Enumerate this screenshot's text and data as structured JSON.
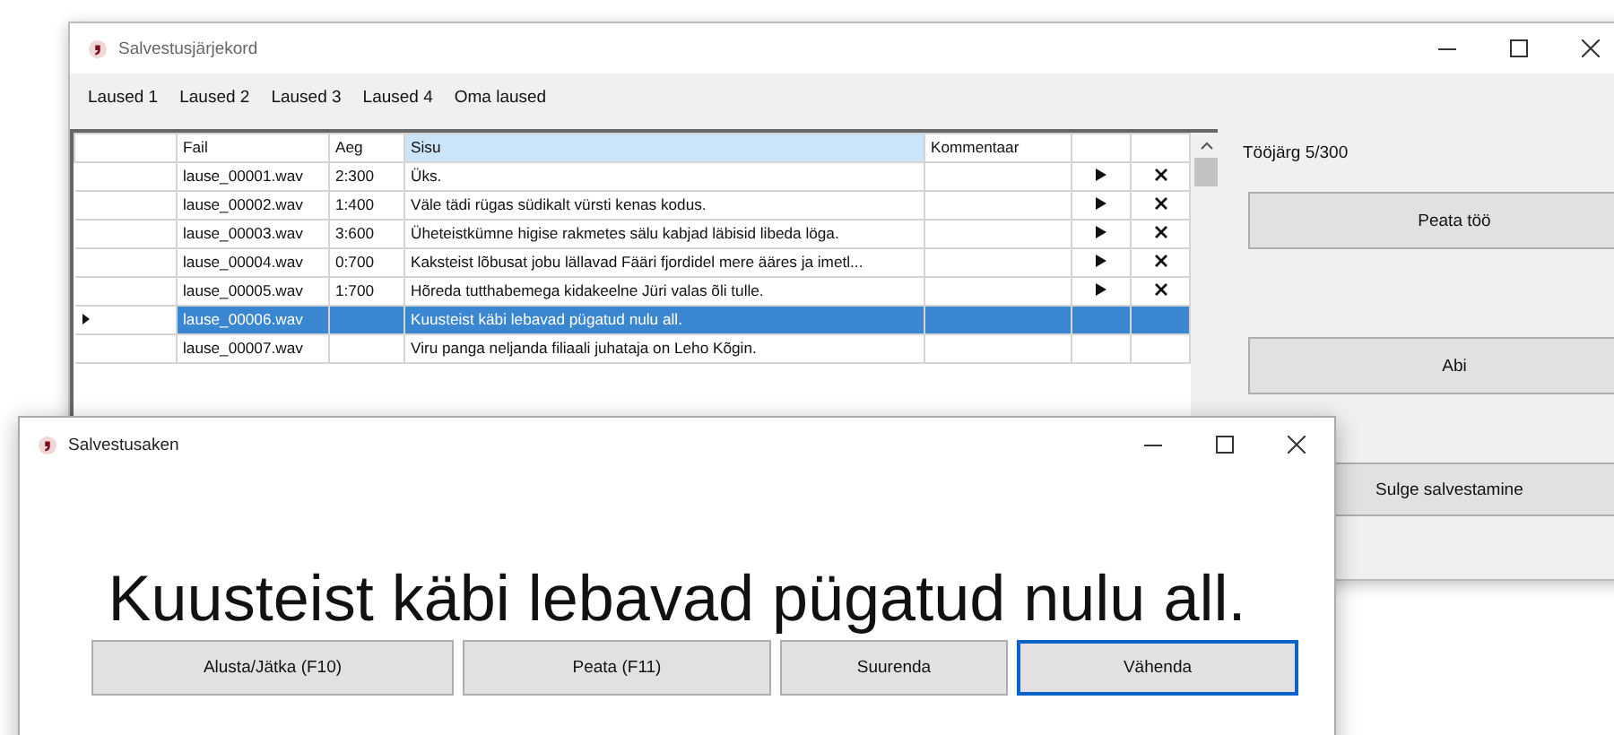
{
  "main_window": {
    "title": "Salvestusjärjekord",
    "menu": [
      "Laused 1",
      "Laused 2",
      "Laused 3",
      "Laused 4",
      "Oma laused"
    ],
    "table": {
      "columns": [
        {
          "label": "Fail",
          "selected": false
        },
        {
          "label": "Aeg",
          "selected": false
        },
        {
          "label": "Sisu",
          "selected": true
        },
        {
          "label": "Kommentaar",
          "selected": false
        }
      ],
      "rows": [
        {
          "file": "lause_00001.wav",
          "time": "2:300",
          "text": "Üks.",
          "recorded": true,
          "selected": false
        },
        {
          "file": "lause_00002.wav",
          "time": "1:400",
          "text": "Väle tädi rügas südikalt vürsti kenas kodus.",
          "recorded": true,
          "selected": false
        },
        {
          "file": "lause_00003.wav",
          "time": "3:600",
          "text": "Üheteistkümne higise rakmetes sälu kabjad läbisid libeda löga.",
          "recorded": true,
          "selected": false
        },
        {
          "file": "lause_00004.wav",
          "time": "0:700",
          "text": "Kaksteist lõbusat jobu lällavad Fääri fjordidel mere ääres ja imetl...",
          "recorded": true,
          "selected": false
        },
        {
          "file": "lause_00005.wav",
          "time": "1:700",
          "text": "Hõreda tutthabemega kidakeelne Jüri valas õli tulle.",
          "recorded": true,
          "selected": false
        },
        {
          "file": "lause_00006.wav",
          "text": "Kuusteist käbi lebavad pügatud nulu all.",
          "recorded": false,
          "selected": true
        },
        {
          "file": "lause_00007.wav",
          "text": "Viru panga neljanda filiaali juhataja on Leho Kõgin.",
          "recorded": false,
          "selected": false
        }
      ]
    },
    "progress": "Tööjärg 5/300",
    "buttons": [
      "Peata töö",
      "Abi",
      "Sulge salvestamine"
    ]
  },
  "recording_window": {
    "title": "Salvestusaken",
    "sentence": "Kuusteist käbi lebavad pügatud nulu all.",
    "buttons": [
      {
        "label": "Alusta/Jätka (F10)",
        "focused": false
      },
      {
        "label": "Peata (F11)",
        "focused": false
      },
      {
        "label": "Suurenda",
        "focused": false
      },
      {
        "label": "Vähenda",
        "focused": true
      }
    ]
  }
}
